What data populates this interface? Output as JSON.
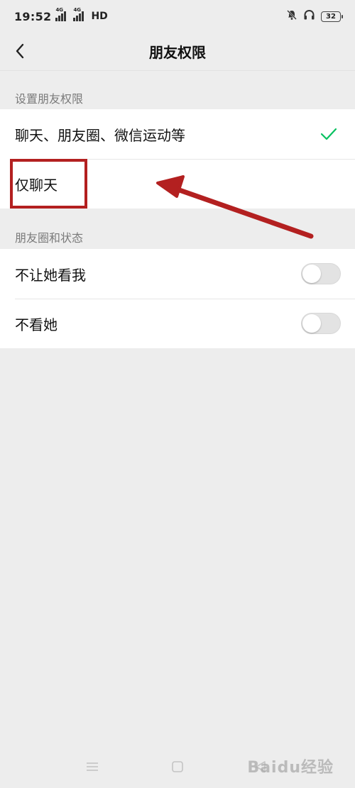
{
  "status_bar": {
    "time": "19:52",
    "network_label": "HD",
    "battery": "32"
  },
  "nav": {
    "title": "朋友权限"
  },
  "section_permissions": {
    "label": "设置朋友权限",
    "options": [
      {
        "label": "聊天、朋友圈、微信运动等",
        "selected": true
      },
      {
        "label": "仅聊天",
        "selected": false
      }
    ]
  },
  "section_moments": {
    "label": "朋友圈和状态",
    "toggles": [
      {
        "label": "不让她看我",
        "on": false
      },
      {
        "label": "不看她",
        "on": false
      }
    ]
  },
  "colors": {
    "accent": "#07c160",
    "annotation": "#b32020",
    "background": "#ededed"
  },
  "icons": {
    "back": "chevron-left-icon",
    "check": "check-icon",
    "mute": "bell-off-icon",
    "headset": "headset-icon"
  },
  "watermark": "Baidu经验"
}
